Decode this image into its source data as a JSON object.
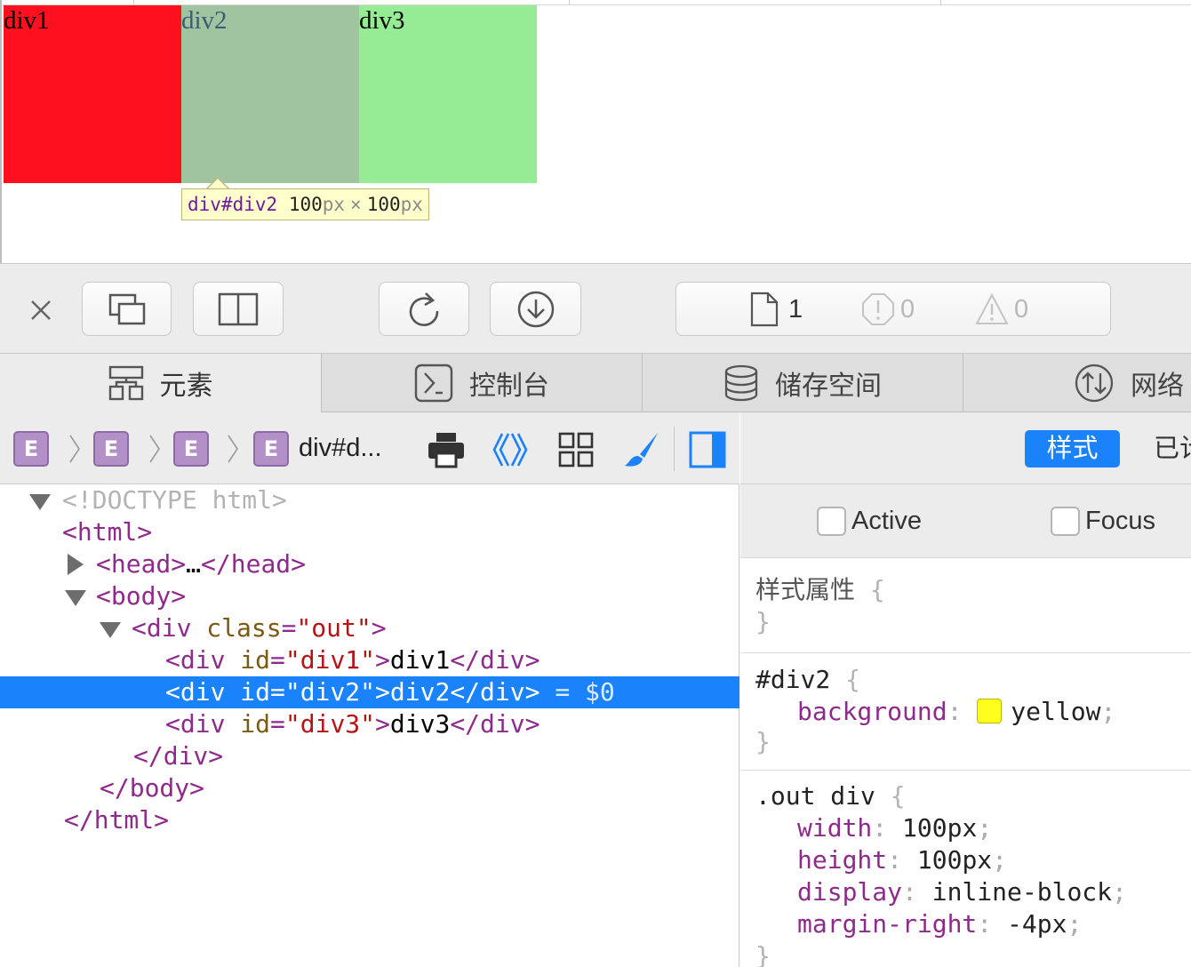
{
  "page": {
    "div1_text": "div1",
    "div2_text": "div2",
    "div3_text": "div3",
    "colors": {
      "div1": "#fe101e",
      "div2": "#a0c4a0",
      "div3": "#95ec95"
    },
    "tooltip": {
      "selector": "div#div2",
      "width": "100",
      "height": "100",
      "unit": "px",
      "times": "×"
    }
  },
  "toolbar": {
    "buttons": [
      "close-icon",
      "undock-icon",
      "split-dock-icon",
      "reload-icon",
      "download-icon"
    ],
    "status": {
      "resources": "1",
      "errors": "0",
      "warnings": "0"
    }
  },
  "tabs": [
    {
      "label": "元素",
      "icon": "elements-icon"
    },
    {
      "label": "控制台",
      "icon": "console-icon"
    },
    {
      "label": "储存空间",
      "icon": "storage-icon"
    },
    {
      "label": "网络",
      "icon": "network-icon"
    }
  ],
  "breadcrumb": {
    "badge": "E",
    "last": "div#d..."
  },
  "dom": {
    "doctype": "<!DOCTYPE html>",
    "html_open": "<html>",
    "head": "<head>",
    "head_ellipsis": "…",
    "head_close": "</head>",
    "body_open": "<body>",
    "div_open": "<div",
    "class_attr": "class",
    "class_val": "\"out\"",
    "id_attr": "id",
    "div1_id": "\"div1\"",
    "div2_id": "\"div2\"",
    "div3_id": "\"div3\"",
    "div1_text": "div1",
    "div2_text": "div2",
    "div3_text": "div3",
    "div_close": "</div>",
    "gt": ">",
    "selected_suffix": "= $0",
    "body_close": "</body>",
    "html_close": "</html>"
  },
  "sidebar": {
    "styles_tab": "样式",
    "computed_tab": "已计",
    "pseudo": [
      "Active",
      "Focus"
    ],
    "style_attribute_label": "样式属性",
    "rule1": {
      "selector": "#div2",
      "prop": "background",
      "value": "yellow"
    },
    "rule2": {
      "selector": ".out div",
      "props": [
        {
          "name": "width",
          "value": "100px"
        },
        {
          "name": "height",
          "value": "100px"
        },
        {
          "name": "display",
          "value": "inline-block"
        },
        {
          "name": "margin-right",
          "value": "-4px"
        }
      ]
    }
  }
}
